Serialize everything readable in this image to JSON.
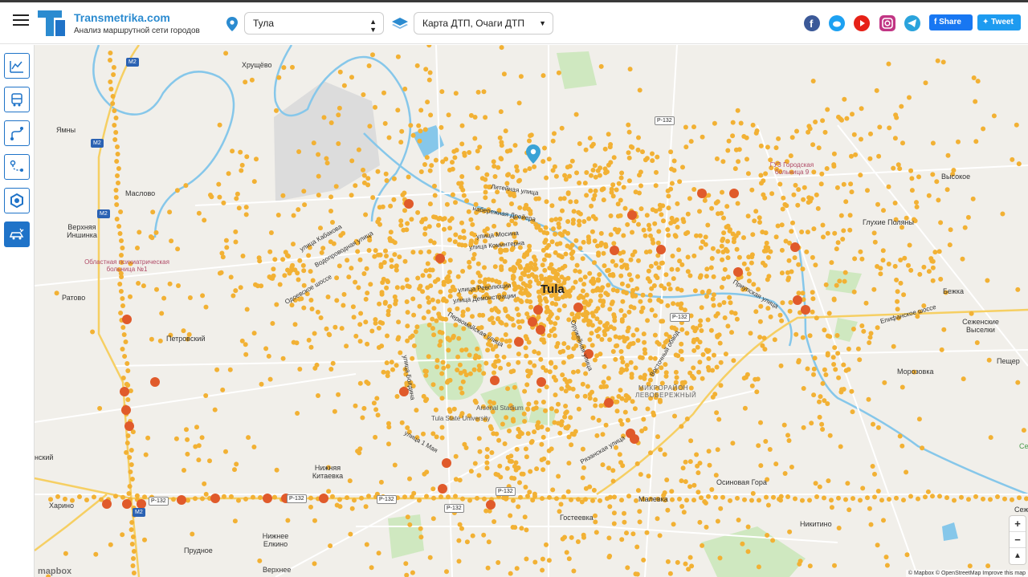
{
  "header": {
    "brand": "Transmetrika.com",
    "tagline": "Анализ маршрутной сети городов",
    "city_select": "Тула",
    "layer_select": "Карта ДТП, Очаги ДТП",
    "share_label": "Share",
    "tweet_label": "Tweet"
  },
  "map": {
    "city": "Tula",
    "places": {
      "khrushchevo": "Хрущёво",
      "yamny": "Ямны",
      "maslovo": "Маслово",
      "verkhnyaya_inshinka": "Верхняя Иншинка",
      "ratovo": "Ратово",
      "petrovsky": "Петровский",
      "kharino": "Харино",
      "nizhnyaya_kitaevka": "Нижняя Китаевка",
      "nizhnee_elkino": "Нижнее Елкино",
      "prudnoe": "Прудное",
      "verkhnee": "Верхнее",
      "vysokoe": "Высокое",
      "glukhie_polyany": "Глухие Поляны",
      "bezhka": "Бежка",
      "sezhenskie_vyselki": "Сеженские Выселки",
      "morozovka": "Морозовка",
      "peshch": "Пещер",
      "osinovaya_gora": "Осиновая Гора",
      "nikitino": "Никитино",
      "maleevka": "Малевка",
      "gosteevka": "Гостеевка",
      "sezh": "Сеже",
      "sezhe": "Сеже",
      "nsk": "нский"
    },
    "pois": {
      "hospital_1": "Областная психиатрическая больница №1",
      "hospital_9": "ГУЗ Городская больница 9",
      "tula_university": "Tula State University",
      "arsenal": "Arsenal Stadium"
    },
    "district": "МИКРОРАЙОН ЛЕВОБЕРЕЖНЫЙ",
    "streets": {
      "litejnaya": "Литейная улица",
      "naberezhnaya": "набережная Дрейера",
      "mosina": "улица Мосина",
      "kominterna": "улица Коминтерна",
      "revolyutsii": "улица Революции",
      "demonstratsii": "улица Демонстрации",
      "pervomajskaya": "Первомайская улица",
      "odoevskoe": "Одоевское шоссе",
      "vodoprovodnaya": "Водопроводная улица",
      "kabakova": "улица Кабакова",
      "ryazanskaya": "Рязанская улица",
      "vostochnyj": "Восточный обвод",
      "prirechnaya": "Приупская улица",
      "elifanskoe": "Епифанское шоссе",
      "may1": "улица 1 Мая",
      "boldina": "улица Болдина",
      "oruzhejnaya": "Оружейная улица"
    },
    "shields": [
      "M2",
      "M2",
      "M2",
      "M2",
      "P-132",
      "P-132",
      "P-132",
      "P-132",
      "P-132",
      "P-132",
      "P-132"
    ],
    "zoom_in": "+",
    "zoom_out": "−",
    "north": "▲",
    "mapbox": "mapbox",
    "attribution": "© Mapbox © OpenStreetMap Improve this map"
  },
  "colors": {
    "accent": "#1f73c8",
    "brand": "#2b8bd0",
    "accident": "#f2b134",
    "hotspot": "#e05a2b",
    "water": "#86c7ea",
    "park": "#cfe8c0"
  }
}
